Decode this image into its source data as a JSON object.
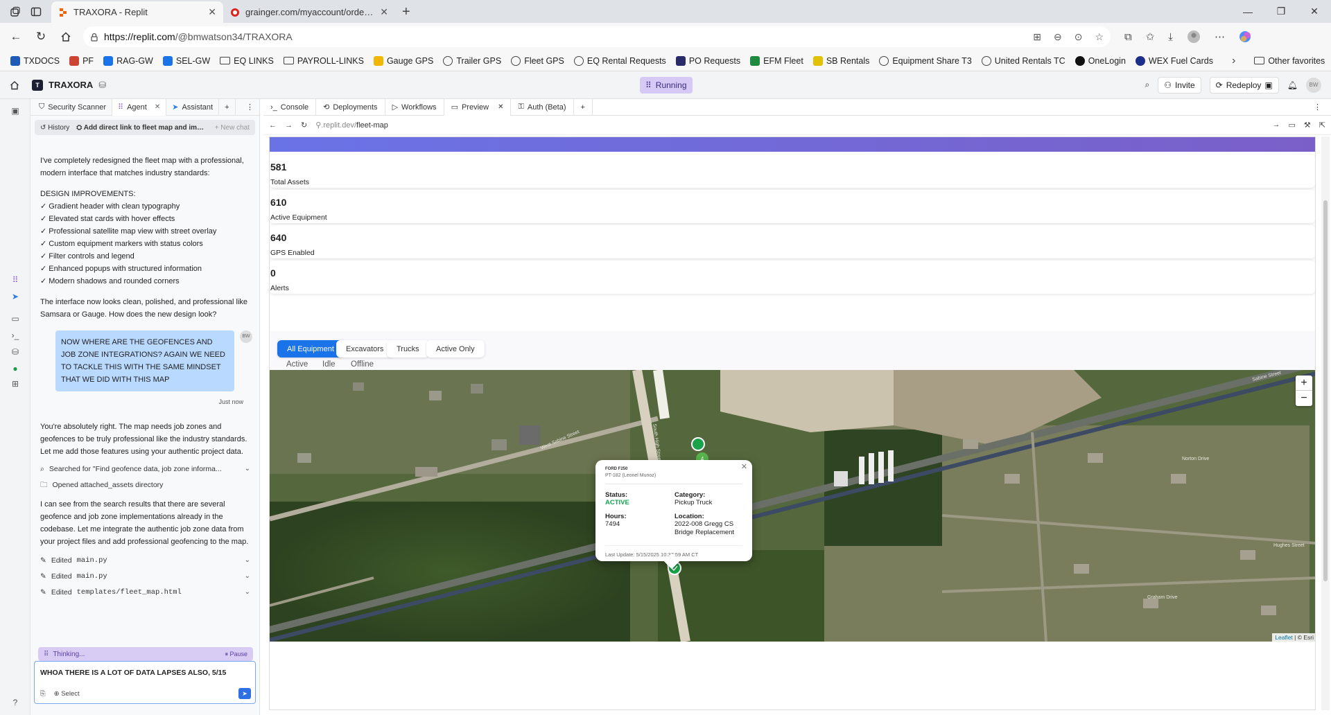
{
  "browser": {
    "tabs": [
      {
        "title": "TRAXORA - Replit",
        "active": true
      },
      {
        "title": "grainger.com/myaccount/orderd...",
        "active": false
      }
    ],
    "url_host": "https://replit.com",
    "url_path": "/@bmwatson34/TRAXORA",
    "bookmarks": [
      "TXDOCS",
      "PF",
      "RAG-GW",
      "SEL-GW",
      "EQ LINKS",
      "PAYROLL-LINKS",
      "Gauge GPS",
      "Trailer GPS",
      "Fleet GPS",
      "EQ Rental Requests",
      "PO Requests",
      "EFM Fleet",
      "SB Rentals",
      "Equipment Share T3",
      "United Rentals TC",
      "OneLogin",
      "WEX Fuel Cards"
    ],
    "other_favorites": "Other favorites"
  },
  "replit": {
    "project_name": "TRAXORA",
    "status": "Running",
    "invite_label": "Invite",
    "redeploy_label": "Redeploy",
    "avatar": "BW"
  },
  "agent_panel": {
    "tabs": [
      "Security Scanner",
      "Agent",
      "Assistant"
    ],
    "history_label": "History",
    "thread_title": "Add direct link to fleet map and impro...",
    "new_chat": "+ New chat",
    "intro_1": "I've completely redesigned the fleet map with a professional, modern interface that matches industry standards:",
    "design_header": "DESIGN IMPROVEMENTS:",
    "improvements": [
      "✓ Gradient header with clean typography",
      "✓ Elevated stat cards with hover effects",
      "✓ Professional satellite map view with street overlay",
      "✓ Custom equipment markers with status colors",
      "✓ Filter controls and legend",
      "✓ Enhanced popups with structured information",
      "✓ Modern shadows and rounded corners"
    ],
    "outro": "The interface now looks clean, polished, and professional like Samsara or Gauge. How does the new design look?",
    "user_message": "NOW WHERE ARE THE GEOFENCES AND JOB ZONE INTEGRATIONS? AGAIN WE NEED TO TACKLE THIS WITH THE SAME MINDSET THAT WE DID WITH THIS MAP",
    "user_avatar": "BW",
    "user_time": "Just now",
    "reply_1": "You're absolutely right. The map needs job zones and geofences to be truly professional like the industry standards. Let me add those features using your authentic project data.",
    "action_search": "Searched for \"Find geofence data, job zone informa...",
    "action_open": "Opened attached_assets directory",
    "reply_2": "I can see from the search results that there are several geofence and job zone implementations already in the codebase. Let me integrate the authentic job zone data from your project files and add professional geofencing to the map.",
    "edits": [
      {
        "verb": "Edited",
        "file": "main.py"
      },
      {
        "verb": "Edited",
        "file": "main.py"
      },
      {
        "verb": "Edited",
        "file": "templates/fleet_map.html"
      }
    ],
    "thinking": "Thinking...",
    "pause": "Pause",
    "input_value": "WHOA THERE IS A LOT OF DATA LAPSES ALSO, 5/15",
    "select_label": "Select"
  },
  "right_panel": {
    "tabs": [
      "Console",
      "Deployments",
      "Workflows",
      "Preview",
      "Auth (Beta)"
    ],
    "preview_url_prefix": ".replit.dev/",
    "preview_url_path": "fleet-map"
  },
  "fleet_map": {
    "stats": [
      {
        "value": "581",
        "label": "Total Assets"
      },
      {
        "value": "610",
        "label": "Active Equipment"
      },
      {
        "value": "640",
        "label": "GPS Enabled"
      },
      {
        "value": "0",
        "label": "Alerts"
      }
    ],
    "filters": [
      "All Equipment",
      "Excavators",
      "Trucks",
      "Active Only"
    ],
    "legend": [
      "Active",
      "Idle",
      "Offline"
    ],
    "cluster_count": "4",
    "popup": {
      "equipment": "FORD F250",
      "asset": "PT-182 (Leonel Munoz)",
      "status_label": "Status:",
      "status_value": "ACTIVE",
      "category_label": "Category:",
      "category_value": "Pickup Truck",
      "hours_label": "Hours:",
      "hours_value": "7494",
      "location_label": "Location:",
      "location_value": "2022-008 Gregg CS Bridge Replacement",
      "last_update": "Last Update: 5/15/2025 10:37:59 AM CT"
    },
    "street_labels": [
      "West Sabine Street",
      "South High Street",
      "Norton Drive",
      "Hughes Street",
      "Graham Drive",
      "Sabine Street"
    ],
    "attribution_link": "Leaflet",
    "attribution_text": " | © Esri"
  },
  "colors": {
    "accent": "#1a73e8",
    "active": "#14a44d",
    "running": "#d6c9f5",
    "header_gradient_start": "#6a73e6",
    "header_gradient_end": "#7a5fc8"
  }
}
